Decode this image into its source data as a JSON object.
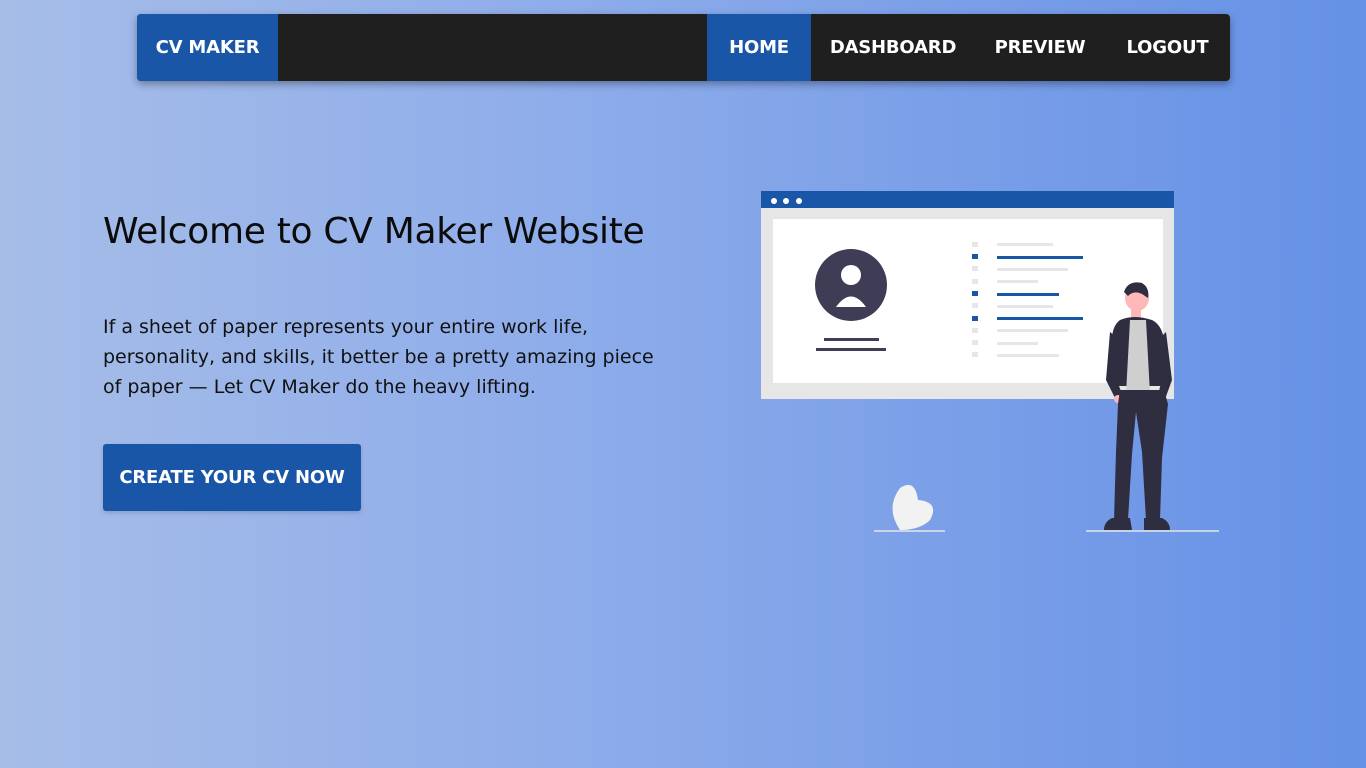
{
  "nav": {
    "brand": "CV MAKER",
    "items": [
      {
        "label": "HOME",
        "active": true
      },
      {
        "label": "DASHBOARD",
        "active": false
      },
      {
        "label": "PREVIEW",
        "active": false
      },
      {
        "label": "LOGOUT",
        "active": false
      }
    ]
  },
  "hero": {
    "title": "Welcome to CV Maker Website",
    "text": "If a sheet of paper represents your entire work life, personality, and skills, it better be a pretty amazing piece of paper — Let CV Maker do the heavy lifting.",
    "cta_label": "CREATE YOUR CV NOW"
  },
  "colors": {
    "accent": "#1a56a8",
    "navbar_bg": "#1f1f1f",
    "gradient_start": "#a6bde8",
    "gradient_end": "#6591e6"
  },
  "illustration": {
    "icon": "resume-presentation-illustration"
  }
}
